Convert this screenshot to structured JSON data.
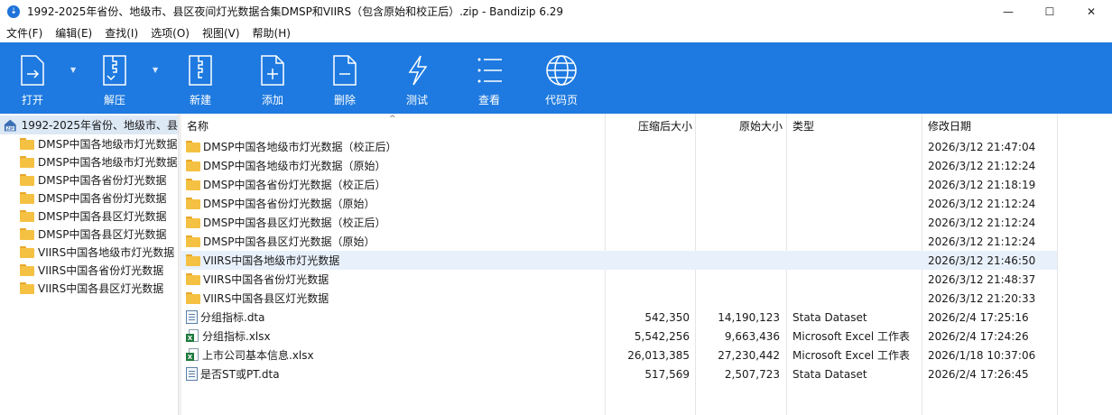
{
  "window": {
    "title": "1992-2025年省份、地级市、县区夜间灯光数据合集DMSP和VIIRS（包含原始和校正后）.zip - Bandizip 6.29",
    "minimize": "—",
    "maximize": "☐",
    "close": "✕"
  },
  "menu": [
    {
      "label": "文件(F)"
    },
    {
      "label": "编辑(E)"
    },
    {
      "label": "查找(I)"
    },
    {
      "label": "选项(O)"
    },
    {
      "label": "视图(V)"
    },
    {
      "label": "帮助(H)"
    }
  ],
  "toolbar": [
    {
      "label": "打开",
      "icon": "open-icon"
    },
    {
      "label": "解压",
      "icon": "extract-icon"
    },
    {
      "label": "新建",
      "icon": "new-archive-icon"
    },
    {
      "label": "添加",
      "icon": "add-icon"
    },
    {
      "label": "删除",
      "icon": "delete-icon"
    },
    {
      "label": "测试",
      "icon": "test-icon"
    },
    {
      "label": "查看",
      "icon": "view-icon"
    },
    {
      "label": "代码页",
      "icon": "codepage-icon"
    }
  ],
  "tree": {
    "root": "1992-2025年省份、地级市、县",
    "items": [
      "DMSP中国各地级市灯光数据",
      "DMSP中国各地级市灯光数据",
      "DMSP中国各省份灯光数据",
      "DMSP中国各省份灯光数据",
      "DMSP中国各县区灯光数据",
      "DMSP中国各县区灯光数据",
      "VIIRS中国各地级市灯光数据",
      "VIIRS中国各省份灯光数据",
      "VIIRS中国各县区灯光数据"
    ]
  },
  "columns": {
    "name": "名称",
    "compressed": "压缩后大小",
    "original": "原始大小",
    "type": "类型",
    "modified": "修改日期"
  },
  "files": [
    {
      "name": "DMSP中国各地级市灯光数据（校正后）",
      "kind": "folder",
      "compressed": "",
      "original": "",
      "type": "",
      "modified": "2026/3/12 21:47:04"
    },
    {
      "name": "DMSP中国各地级市灯光数据（原始）",
      "kind": "folder",
      "compressed": "",
      "original": "",
      "type": "",
      "modified": "2026/3/12 21:12:24"
    },
    {
      "name": "DMSP中国各省份灯光数据（校正后）",
      "kind": "folder",
      "compressed": "",
      "original": "",
      "type": "",
      "modified": "2026/3/12 21:18:19"
    },
    {
      "name": "DMSP中国各省份灯光数据（原始）",
      "kind": "folder",
      "compressed": "",
      "original": "",
      "type": "",
      "modified": "2026/3/12 21:12:24"
    },
    {
      "name": "DMSP中国各县区灯光数据（校正后）",
      "kind": "folder",
      "compressed": "",
      "original": "",
      "type": "",
      "modified": "2026/3/12 21:12:24"
    },
    {
      "name": "DMSP中国各县区灯光数据（原始）",
      "kind": "folder",
      "compressed": "",
      "original": "",
      "type": "",
      "modified": "2026/3/12 21:12:24"
    },
    {
      "name": "VIIRS中国各地级市灯光数据",
      "kind": "folder",
      "compressed": "",
      "original": "",
      "type": "",
      "modified": "2026/3/12 21:46:50",
      "highlighted": true
    },
    {
      "name": "VIIRS中国各省份灯光数据",
      "kind": "folder",
      "compressed": "",
      "original": "",
      "type": "",
      "modified": "2026/3/12 21:48:37"
    },
    {
      "name": "VIIRS中国各县区灯光数据",
      "kind": "folder",
      "compressed": "",
      "original": "",
      "type": "",
      "modified": "2026/3/12 21:20:33"
    },
    {
      "name": "分组指标.dta",
      "kind": "dta",
      "compressed": "542,350",
      "original": "14,190,123",
      "type": "Stata Dataset",
      "modified": "2026/2/4 17:25:16"
    },
    {
      "name": "分组指标.xlsx",
      "kind": "xlsx",
      "compressed": "5,542,256",
      "original": "9,663,436",
      "type": "Microsoft Excel 工作表",
      "modified": "2026/2/4 17:24:26"
    },
    {
      "name": "上市公司基本信息.xlsx",
      "kind": "xlsx",
      "compressed": "26,013,385",
      "original": "27,230,442",
      "type": "Microsoft Excel 工作表",
      "modified": "2026/1/18 10:37:06"
    },
    {
      "name": "是否ST或PT.dta",
      "kind": "dta",
      "compressed": "517,569",
      "original": "2,507,723",
      "type": "Stata Dataset",
      "modified": "2026/2/4 17:26:45"
    }
  ],
  "colors": {
    "toolbar_bg": "#1e7ae0",
    "row_highlight": "#e8f1fb",
    "folder": "#f5c142"
  }
}
